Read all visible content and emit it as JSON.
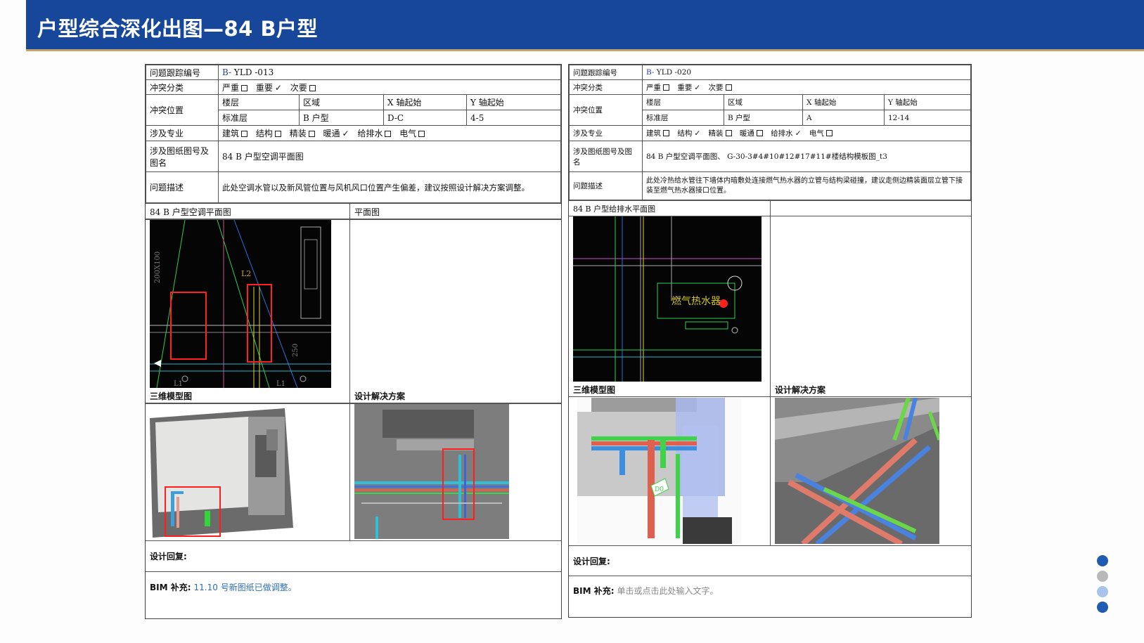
{
  "header": {
    "title": "户型综合深化出图—84 B户型"
  },
  "left": {
    "labels": {
      "track": "问题跟踪编号",
      "category": "冲突分类",
      "location": "冲突位置",
      "discipline": "涉及专业",
      "drawing": "涉及图纸图号及图名",
      "desc": "问题描述"
    },
    "track_prefix": "B-",
    "track_id": " YLD -013",
    "category": [
      {
        "label": "严重",
        "checked": false
      },
      {
        "label": "重要",
        "checked": true
      },
      {
        "label": "次要",
        "checked": false
      }
    ],
    "location_heads": [
      "楼层",
      "区域",
      "X 轴起始",
      "Y 轴起始"
    ],
    "location_vals": [
      "标准层",
      "B 户型",
      "D-C",
      "4-5"
    ],
    "disciplines": [
      {
        "label": "建筑",
        "checked": false
      },
      {
        "label": "结构",
        "checked": false
      },
      {
        "label": "精装",
        "checked": false
      },
      {
        "label": "暖通",
        "checked": true
      },
      {
        "label": "给排水",
        "checked": false
      },
      {
        "label": "电气",
        "checked": false
      }
    ],
    "drawing": "84 B 户型空调平面图",
    "desc": "此处空调水管以及新风管位置与风机风口位置产生偏差，建议按照设计解决方案调整。",
    "plan1": "84 B 户型空调平面图",
    "plan2": "平面图",
    "model_label": "三维模型图",
    "solution_label": "设计解决方案",
    "reply_label": "设计回复:",
    "bim_label": "BIM 补充:",
    "bim_value": "11.10 号新图纸已做调整。",
    "cad_text": [
      "L1",
      "L2",
      "250",
      "200X100",
      "L1"
    ]
  },
  "right": {
    "labels": {
      "track": "问题跟踪编号",
      "category": "冲突分类",
      "location": "冲突位置",
      "discipline": "涉及专业",
      "drawing": "涉及图纸图号及图名",
      "desc": "问题描述"
    },
    "track_prefix": "B-",
    "track_id": " YLD -020",
    "category": [
      {
        "label": "严重",
        "checked": false
      },
      {
        "label": "重要",
        "checked": true
      },
      {
        "label": "次要",
        "checked": false
      }
    ],
    "location_heads": [
      "楼层",
      "区域",
      "X 轴起始",
      "Y 轴起始"
    ],
    "location_vals": [
      "标准层",
      "B 户型",
      "A",
      "12-14"
    ],
    "disciplines": [
      {
        "label": "建筑",
        "checked": false
      },
      {
        "label": "结构",
        "checked": true
      },
      {
        "label": "精装",
        "checked": false
      },
      {
        "label": "暖通",
        "checked": false
      },
      {
        "label": "给排水",
        "checked": true
      },
      {
        "label": "电气",
        "checked": false
      }
    ],
    "drawing": "84 B 户型空调平面图、 G-30-3#4#10#12#17#11#楼结构模板图_t3",
    "desc": "此处冷热给水管往下墙体内暗敷处连接燃气热水器的立管与结构梁碰撞，建议走侧边精装面层立管下接装至燃气热水器接口位置。",
    "plan1": "84 B 户型给排水平面图",
    "plan2": "",
    "model_label": "三维模型图",
    "solution_label": "设计解决方案",
    "reply_label": "设计回复:",
    "bim_label": "BIM 补充:",
    "bim_value": "单击或点击此处输入文字。",
    "cad_text": [
      "燃气热水器"
    ],
    "model_text": "D0"
  },
  "pagination": {
    "colors": [
      "#1f5bb0",
      "#b9b9b9",
      "#a9c4ea",
      "#1f5bb0"
    ]
  },
  "icons": {
    "check": "✓",
    "checkbox": "checkbox-empty"
  }
}
